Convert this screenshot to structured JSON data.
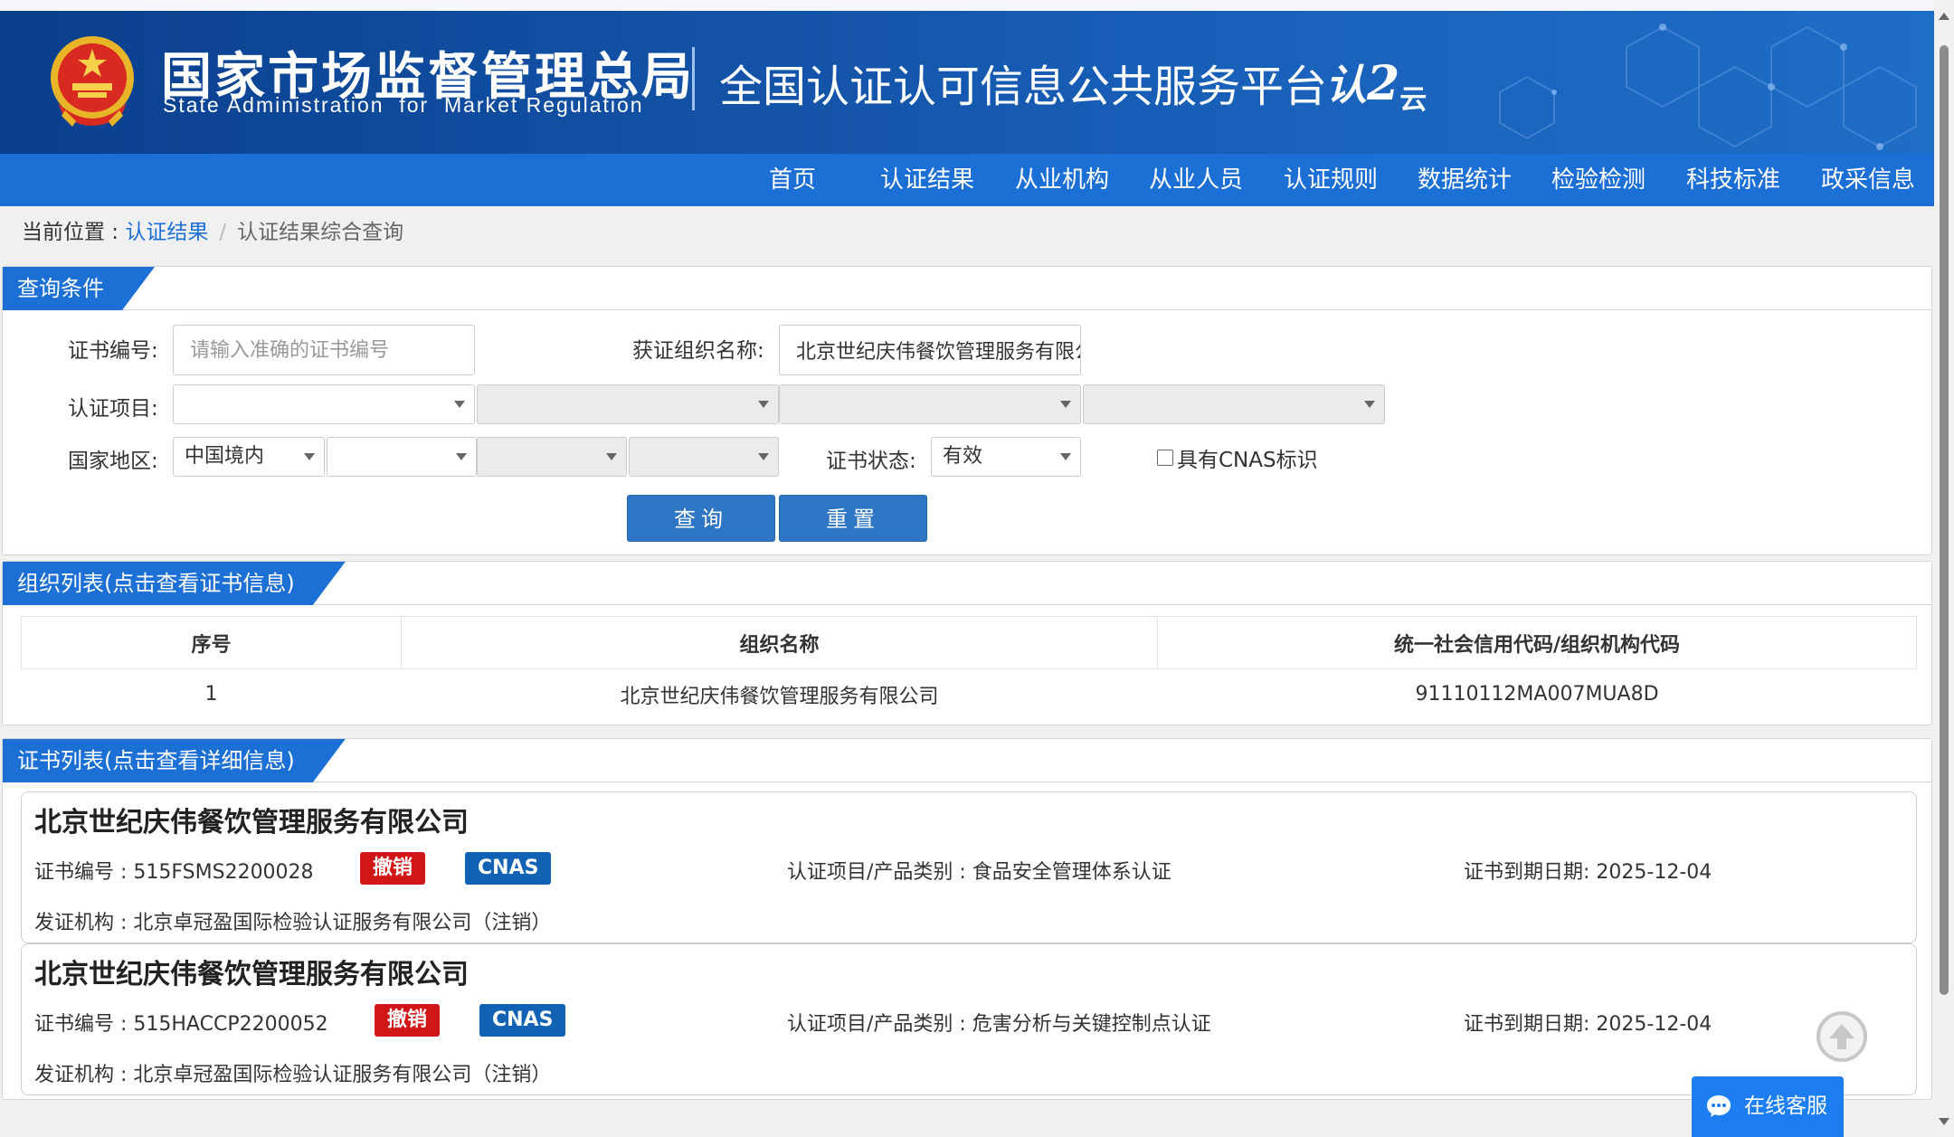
{
  "header": {
    "agency_cn": "国家市场监督管理总局",
    "agency_en": "State Administration  for  Market Regulation",
    "platform_title": "全国认证认可信息公共服务平台",
    "logo_mark": "认",
    "logo_suffix": "云"
  },
  "nav": {
    "items": [
      "首页",
      "认证结果",
      "从业机构",
      "从业人员",
      "认证规则",
      "数据统计",
      "检验检测",
      "科技标准",
      "政采信息"
    ]
  },
  "breadcrumb": {
    "prefix": "当前位置 : ",
    "link": "认证结果",
    "separator": "/",
    "current": "认证结果综合查询"
  },
  "query_panel": {
    "title": "查询条件",
    "cert_no_label": "证书编号:",
    "cert_no_placeholder": "请输入准确的证书编号",
    "org_name_label": "获证组织名称:",
    "org_name_value": "北京世纪庆伟餐饮管理服务有限公司",
    "cert_project_label": "认证项目:",
    "region_label": "国家地区:",
    "region_value": "中国境内",
    "status_label": "证书状态:",
    "status_value": "有效",
    "cnas_label": "具有CNAS标识",
    "search_button": "查询",
    "reset_button": "重置"
  },
  "org_panel": {
    "title": "组织列表(点击查看证书信息)",
    "columns": [
      "序号",
      "组织名称",
      "统一社会信用代码/组织机构代码"
    ],
    "rows": [
      {
        "index": "1",
        "name": "北京世纪庆伟餐饮管理服务有限公司",
        "code": "91110112MA007MUA8D"
      }
    ]
  },
  "cert_panel": {
    "title": "证书列表(点击查看详细信息)",
    "cards": [
      {
        "org": "北京世纪庆伟餐饮管理服务有限公司",
        "cert_no": "证书编号 : 515FSMS2200028",
        "status_badge": "撤销",
        "cnas_badge": "CNAS",
        "category": "认证项目/产品类别 : 食品安全管理体系认证",
        "expiry": "证书到期日期: 2025-12-04",
        "issuer": "发证机构 : 北京卓冠盈国际检验认证服务有限公司（注销）"
      },
      {
        "org": "北京世纪庆伟餐饮管理服务有限公司",
        "cert_no": "证书编号 : 515HACCP2200052",
        "status_badge": "撤销",
        "cnas_badge": "CNAS",
        "category": "认证项目/产品类别 : 危害分析与关键控制点认证",
        "expiry": "证书到期日期: 2025-12-04",
        "issuer": "发证机构 : 北京卓冠盈国际检验认证服务有限公司（注销）"
      }
    ]
  },
  "widgets": {
    "online_service": "在线客服",
    "back_to_top_icon": "arrow-up-circle-icon"
  },
  "colors": {
    "primary_blue": "#1c6fd4",
    "revoked_red": "#d01616",
    "cnas_blue": "#1162b5"
  }
}
